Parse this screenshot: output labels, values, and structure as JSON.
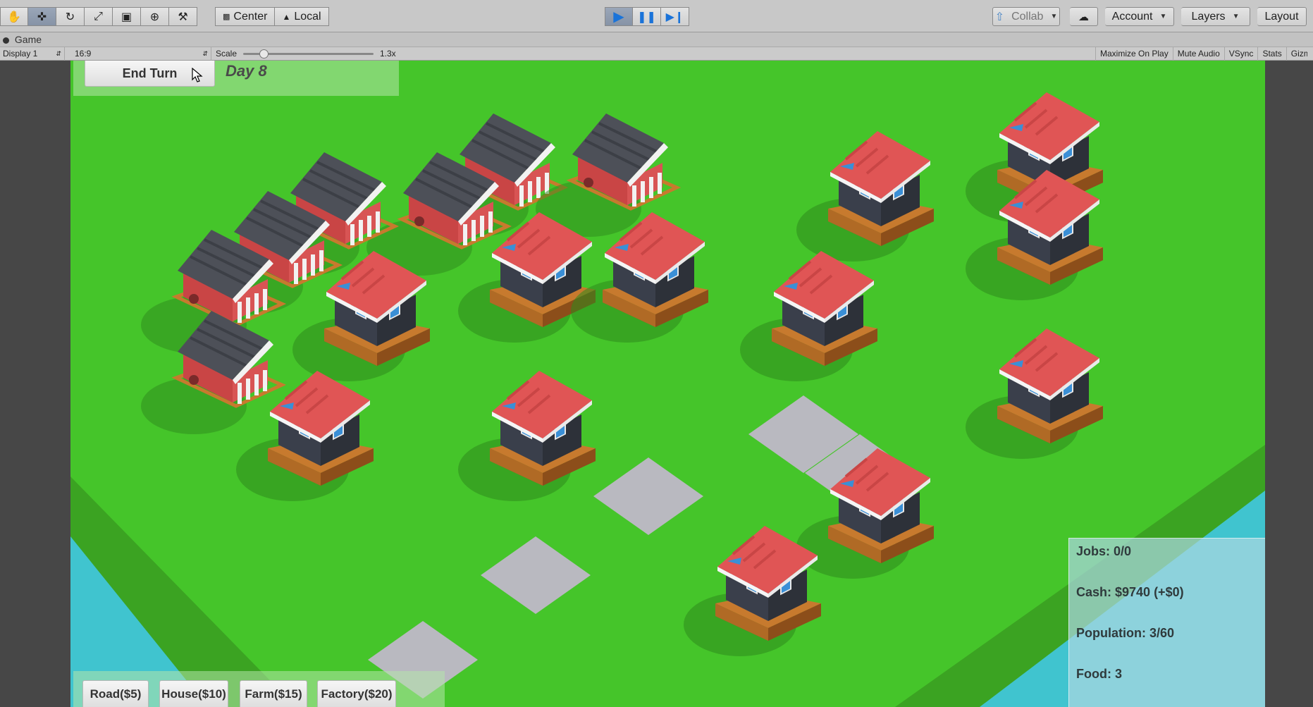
{
  "toolbar": {
    "tools": [
      {
        "name": "hand-tool",
        "icon": "hand-icon",
        "glyph": "✋",
        "active": false
      },
      {
        "name": "move-tool",
        "icon": "move-icon",
        "glyph": "✜",
        "active": true
      },
      {
        "name": "rotate-tool",
        "icon": "rotate-icon",
        "glyph": "↻",
        "active": false
      },
      {
        "name": "scale-tool",
        "icon": "scale-icon",
        "glyph": "⤢",
        "active": false
      },
      {
        "name": "rect-tool",
        "icon": "rect-transform-icon",
        "glyph": "▣",
        "active": false
      },
      {
        "name": "transform-tool",
        "icon": "transform-icon",
        "glyph": "⊕",
        "active": false
      },
      {
        "name": "custom-tool",
        "icon": "custom-tool-icon",
        "glyph": "⚒",
        "active": false
      }
    ],
    "pivot_mode": "Center",
    "pivot_rotation": "Local",
    "collab_label": "Collab",
    "account_label": "Account",
    "layers_label": "Layers",
    "layout_label": "Layout",
    "play_state": {
      "playing": true,
      "paused": false
    }
  },
  "game_tab": {
    "title": "Game"
  },
  "game_bar": {
    "display": "Display 1",
    "aspect": "16:9",
    "scale_label": "Scale",
    "scale_value": "1.3x",
    "scale_fraction": 0.15,
    "maximize": "Maximize On Play",
    "mute": "Mute Audio",
    "vsync": "VSync",
    "stats": "Stats",
    "gizmos": "Gizmos"
  },
  "hud": {
    "end_turn_label": "End Turn",
    "day_label": "Day 8",
    "build_buttons": [
      "Road($5)",
      "House($10)",
      "Farm($15)",
      "Factory($20)"
    ],
    "stats": {
      "jobs": "Jobs: 0/0",
      "cash": "Cash: $9740 (+$0)",
      "population": "Population: 3/60",
      "food": "Food: 3"
    }
  },
  "colors": {
    "grass": "#47c42a",
    "grass_edge": "#3aa022",
    "water": "#40c4cf",
    "road": "#b9b9c0",
    "roof_red": "#e05555",
    "barn_roof": "#4d5058",
    "wood": "#c77a2e",
    "house_wall": "#3a3f4b",
    "window_blue": "#3a8fd6"
  }
}
